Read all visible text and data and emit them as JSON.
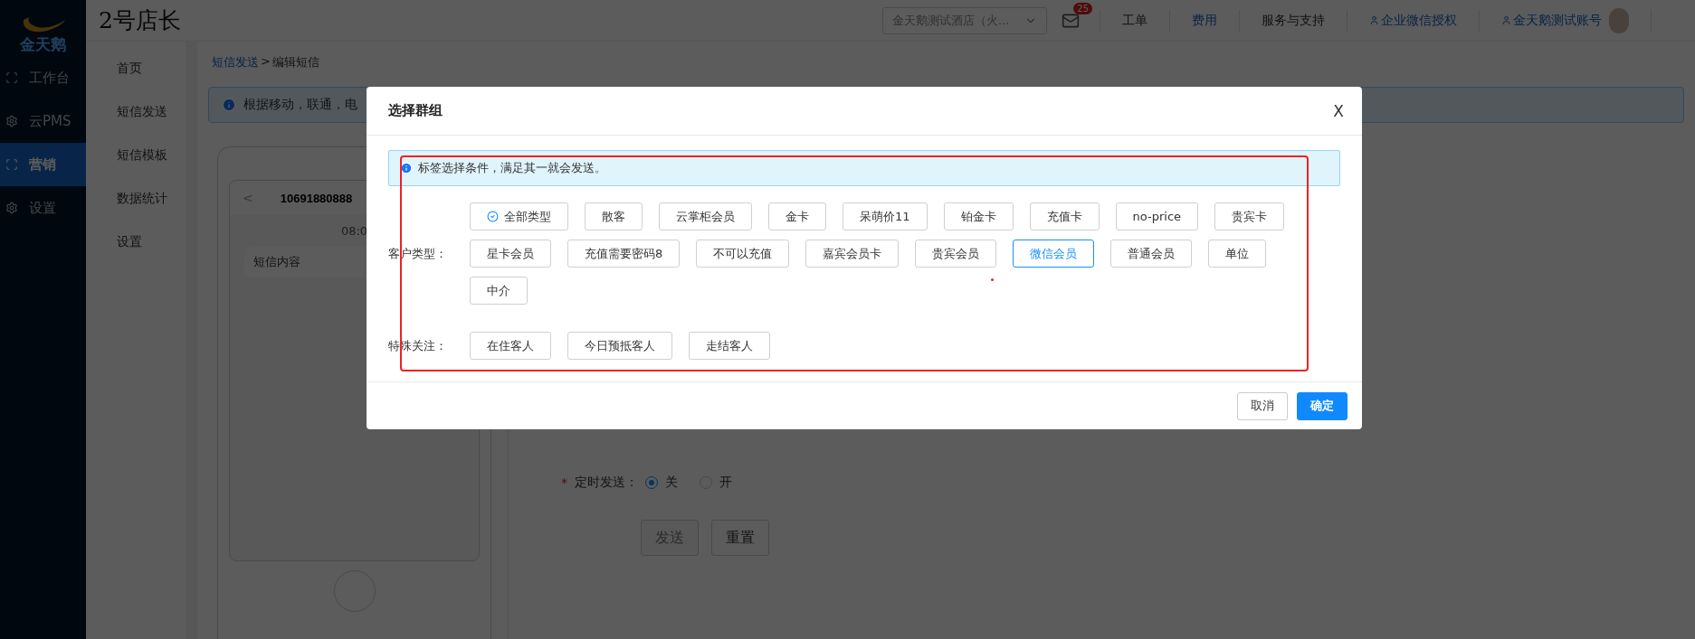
{
  "logo": {
    "text": "金天鹅"
  },
  "sidebar": {
    "items": [
      {
        "label": "工作台",
        "kind": "scan",
        "selected": false
      },
      {
        "label": "云PMS",
        "kind": "gear",
        "selected": false
      },
      {
        "label": "营销",
        "kind": "scan",
        "selected": true
      },
      {
        "label": "设置",
        "kind": "gear",
        "selected": false
      }
    ]
  },
  "topbar": {
    "brand": "2号店长",
    "hotel_select": {
      "value": "金天鹅测试酒店（火..."
    },
    "mail_badge": "25",
    "nav": [
      {
        "label": "工单",
        "kind": "plain",
        "selected": false
      },
      {
        "label": "费用",
        "kind": "plain",
        "selected": true
      },
      {
        "label": "服务与支持",
        "kind": "plain",
        "selected": false
      },
      {
        "label": "企业微信授权",
        "kind": "user",
        "selected": true
      },
      {
        "label": "金天鹅测试账号",
        "kind": "user",
        "selected": true
      }
    ]
  },
  "submenu": {
    "items": [
      "首页",
      "短信发送",
      "短信模板",
      "数据统计",
      "设置"
    ]
  },
  "breadcrumb": {
    "link": "短信发送",
    "separator": ">",
    "current": "编辑短信"
  },
  "alert": {
    "text": "根据移动，联通，电"
  },
  "phone": {
    "number": "10691880888",
    "back": "<",
    "time": "08:0",
    "message": "短信内容"
  },
  "form": {
    "schedule": {
      "label": "定时发送：",
      "required_mark": "*",
      "options": [
        {
          "label": "关",
          "selected": true
        },
        {
          "label": "开",
          "selected": false
        }
      ]
    },
    "buttons": [
      {
        "label": "发送",
        "disabled": true
      },
      {
        "label": "重置",
        "disabled": false
      }
    ]
  },
  "modal": {
    "title": "选择群组",
    "close": "X",
    "info": "标签选择条件，满足其一就会发送。",
    "groups": [
      {
        "label": "客户类型：",
        "options": [
          {
            "label": "全部类型",
            "kind": "all",
            "selected": false
          },
          {
            "label": "散客",
            "kind": "tag",
            "selected": false
          },
          {
            "label": "云掌柜会员",
            "kind": "tag",
            "selected": false
          },
          {
            "label": "金卡",
            "kind": "tag",
            "selected": false
          },
          {
            "label": "呆萌价11",
            "kind": "tag",
            "selected": false
          },
          {
            "label": "铂金卡",
            "kind": "tag",
            "selected": false
          },
          {
            "label": "充值卡",
            "kind": "tag",
            "selected": false
          },
          {
            "label": "no-price",
            "kind": "tag",
            "selected": false
          },
          {
            "label": "贵宾卡",
            "kind": "tag",
            "selected": false
          },
          {
            "label": "星卡会员",
            "kind": "tag",
            "selected": false
          },
          {
            "label": "充值需要密码8",
            "kind": "tag",
            "selected": false
          },
          {
            "label": "不可以充值",
            "kind": "tag",
            "selected": false
          },
          {
            "label": "嘉宾会员卡",
            "kind": "tag",
            "selected": false
          },
          {
            "label": "贵宾会员",
            "kind": "tag",
            "selected": false
          },
          {
            "label": "微信会员",
            "kind": "tag",
            "selected": true
          },
          {
            "label": "普通会员",
            "kind": "tag",
            "selected": false
          },
          {
            "label": "单位",
            "kind": "tag",
            "selected": false
          },
          {
            "label": "中介",
            "kind": "tag",
            "selected": false
          }
        ]
      },
      {
        "label": "特殊关注：",
        "options": [
          {
            "label": "在住客人",
            "kind": "tag",
            "selected": false
          },
          {
            "label": "今日预抵客人",
            "kind": "tag",
            "selected": false
          },
          {
            "label": "走结客人",
            "kind": "tag",
            "selected": false
          }
        ]
      }
    ],
    "buttons": [
      {
        "label": "取消",
        "kind": "default"
      },
      {
        "label": "确定",
        "kind": "primary"
      }
    ]
  }
}
